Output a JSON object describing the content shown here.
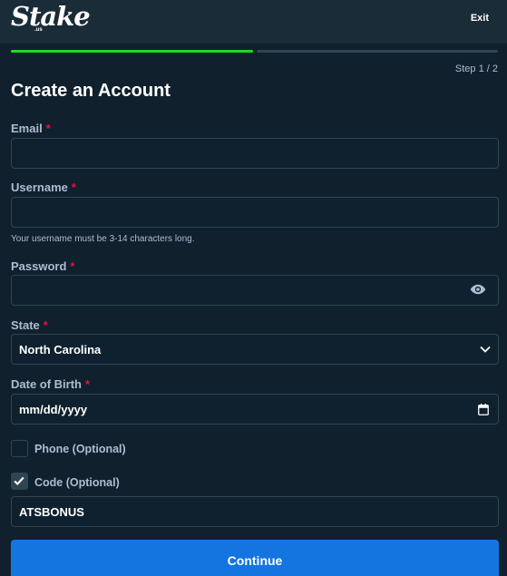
{
  "header": {
    "logo_text": "Stake",
    "logo_sub": ".us",
    "exit_label": "Exit"
  },
  "progress": {
    "current_step": 1,
    "total_steps": 2
  },
  "step_label": "Step 1 / 2",
  "page_title": "Create an Account",
  "required_marker": "*",
  "fields": {
    "email": {
      "label": "Email",
      "value": "",
      "placeholder": ""
    },
    "username": {
      "label": "Username",
      "value": "",
      "hint": "Your username must be 3-14 characters long."
    },
    "password": {
      "label": "Password",
      "value": ""
    },
    "state": {
      "label": "State",
      "selected": "North Carolina"
    },
    "dob": {
      "label": "Date of Birth",
      "placeholder": "mm/dd/yyyy"
    },
    "phone": {
      "label": "Phone (Optional)",
      "checked": false
    },
    "code": {
      "label": "Code (Optional)",
      "checked": true,
      "value": "ATSBONUS"
    }
  },
  "continue_label": "Continue",
  "colors": {
    "background": "#10212d",
    "header": "#1a2c38",
    "progress_active": "#1fdc1f",
    "accent_button": "#1475e1",
    "required": "#e9113c",
    "label": "#b1bad3"
  },
  "icons": [
    "eye-icon",
    "chevron-down-icon",
    "calendar-icon",
    "checkmark-icon"
  ]
}
